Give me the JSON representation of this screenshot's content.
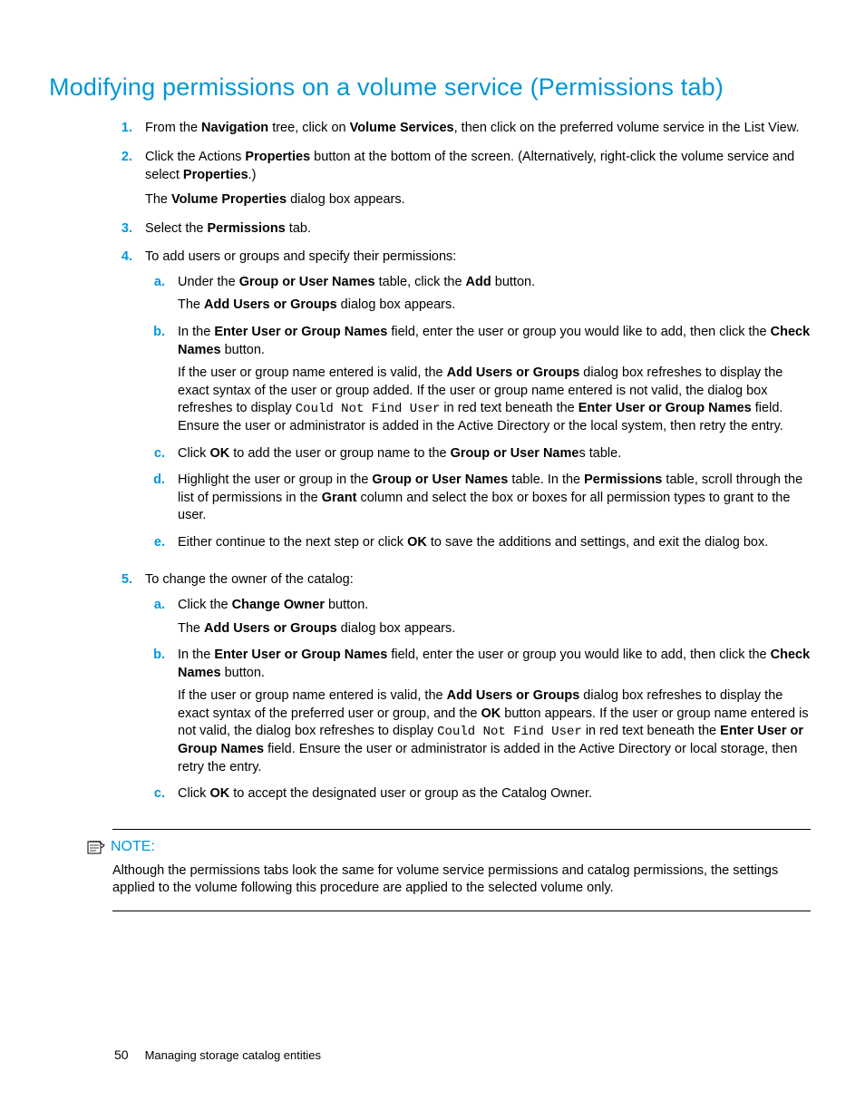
{
  "heading": "Modifying permissions on a volume service (Permissions tab)",
  "step1": {
    "marker": "1.",
    "t1": "From the ",
    "b1": "Navigation",
    "t2": " tree, click on ",
    "b2": "Volume Services",
    "t3": ", then click on the preferred volume service in the List View."
  },
  "step2": {
    "marker": "2.",
    "t1": "Click the Actions ",
    "b1": "Properties",
    "t2": " button at the bottom of the screen. (Alternatively, right-click the volume service and select ",
    "b2": "Properties",
    "t3": ".)",
    "p2a": "The ",
    "p2b": "Volume Properties",
    "p2c": " dialog box appears."
  },
  "step3": {
    "marker": "3.",
    "t1": "Select the ",
    "b1": "Permissions",
    "t2": " tab."
  },
  "step4": {
    "marker": "4.",
    "intro": "To add users or groups and specify their permissions:",
    "a": {
      "m": "a.",
      "t1": "Under the ",
      "b1": "Group or User Names",
      "t2": " table, click the ",
      "b2": "Add",
      "t3": " button.",
      "p2a": "The ",
      "p2b": "Add Users or Groups",
      "p2c": " dialog box appears."
    },
    "b": {
      "m": "b.",
      "t1": "In the ",
      "b1": "Enter User or Group Names",
      "t2": " field, enter the user or group you would like to add, then click the ",
      "b2": "Check Names",
      "t3": " button.",
      "p2a": "If the user or group name entered is valid, the ",
      "p2b": "Add Users or Groups",
      "p2c": " dialog box refreshes to display the exact syntax of the user or group added. If the user or group name entered is not valid, the dialog box refreshes to display ",
      "code": "Could Not Find User",
      "p2d": " in red text beneath the ",
      "p2e": "Enter User or Group Names",
      "p2f": " field. Ensure the user or administrator is added in the Active Directory or the local system, then retry the entry."
    },
    "c": {
      "m": "c.",
      "t1": "Click ",
      "b1": "OK",
      "t2": " to add the user or group name to the ",
      "b2": "Group or User Name",
      "t3": "s table."
    },
    "d": {
      "m": "d.",
      "t1": "Highlight the user or group in the ",
      "b1": "Group or User Names",
      "t2": " table. In the ",
      "b2": "Permissions",
      "t3": " table, scroll through the list of permissions in the ",
      "b3": "Grant",
      "t4": " column and select the box or boxes for all permission types to grant to the user."
    },
    "e": {
      "m": "e.",
      "t1": "Either continue to the next step or click ",
      "b1": "OK",
      "t2": " to save the additions and settings, and exit the dialog box."
    }
  },
  "step5": {
    "marker": "5.",
    "intro": "To change the owner of the catalog:",
    "a": {
      "m": "a.",
      "t1": "Click the ",
      "b1": "Change Owner",
      "t2": " button.",
      "p2a": "The ",
      "p2b": "Add Users or Groups",
      "p2c": " dialog box appears."
    },
    "b": {
      "m": "b.",
      "t1": "In the ",
      "b1": "Enter User or Group Names",
      "t2": " field, enter the user or group you would like to add, then click the ",
      "b2": "Check Names",
      "t3": " button.",
      "p2a": "If the user or group name entered is valid, the ",
      "p2b": "Add Users or Groups",
      "p2c": " dialog box refreshes to display the exact syntax of the preferred user or group, and the ",
      "p2d": "OK",
      "p2e": " button appears. If the user or group name entered is not valid, the dialog box refreshes to display ",
      "code": "Could Not Find User",
      "p2f": " in red text beneath the ",
      "p2g": "Enter User or Group Names",
      "p2h": " field. Ensure the user or administrator is added in the Active Directory or local storage, then retry the entry."
    },
    "c": {
      "m": "c.",
      "t1": "Click ",
      "b1": "OK",
      "t2": " to accept the designated user or group as the Catalog Owner."
    }
  },
  "note": {
    "label": "NOTE:",
    "text": "Although the permissions tabs look the same for volume service permissions and catalog permissions, the settings applied to the volume following this procedure are applied to the selected volume only."
  },
  "footer": {
    "page": "50",
    "section": "Managing storage catalog entities"
  }
}
